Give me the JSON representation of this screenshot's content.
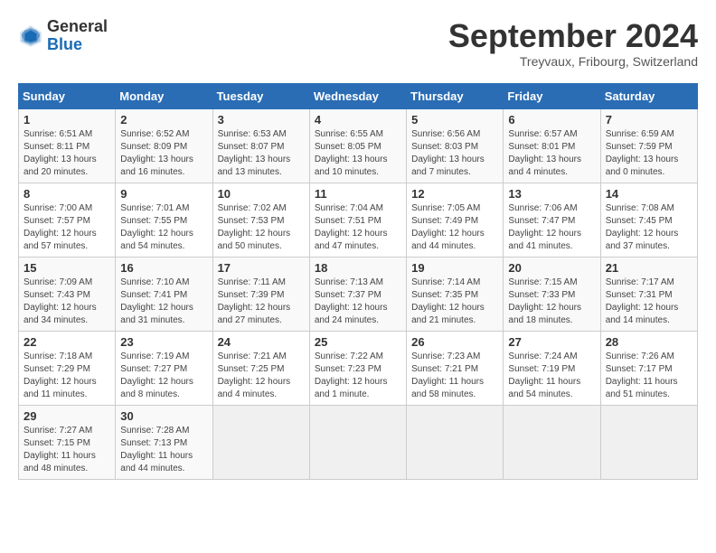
{
  "logo": {
    "general": "General",
    "blue": "Blue"
  },
  "title": "September 2024",
  "location": "Treyvaux, Fribourg, Switzerland",
  "headers": [
    "Sunday",
    "Monday",
    "Tuesday",
    "Wednesday",
    "Thursday",
    "Friday",
    "Saturday"
  ],
  "weeks": [
    [
      {
        "day": "1",
        "sunrise": "6:51 AM",
        "sunset": "8:11 PM",
        "daylight": "13 hours and 20 minutes."
      },
      {
        "day": "2",
        "sunrise": "6:52 AM",
        "sunset": "8:09 PM",
        "daylight": "13 hours and 16 minutes."
      },
      {
        "day": "3",
        "sunrise": "6:53 AM",
        "sunset": "8:07 PM",
        "daylight": "13 hours and 13 minutes."
      },
      {
        "day": "4",
        "sunrise": "6:55 AM",
        "sunset": "8:05 PM",
        "daylight": "13 hours and 10 minutes."
      },
      {
        "day": "5",
        "sunrise": "6:56 AM",
        "sunset": "8:03 PM",
        "daylight": "13 hours and 7 minutes."
      },
      {
        "day": "6",
        "sunrise": "6:57 AM",
        "sunset": "8:01 PM",
        "daylight": "13 hours and 4 minutes."
      },
      {
        "day": "7",
        "sunrise": "6:59 AM",
        "sunset": "7:59 PM",
        "daylight": "13 hours and 0 minutes."
      }
    ],
    [
      {
        "day": "8",
        "sunrise": "7:00 AM",
        "sunset": "7:57 PM",
        "daylight": "12 hours and 57 minutes."
      },
      {
        "day": "9",
        "sunrise": "7:01 AM",
        "sunset": "7:55 PM",
        "daylight": "12 hours and 54 minutes."
      },
      {
        "day": "10",
        "sunrise": "7:02 AM",
        "sunset": "7:53 PM",
        "daylight": "12 hours and 50 minutes."
      },
      {
        "day": "11",
        "sunrise": "7:04 AM",
        "sunset": "7:51 PM",
        "daylight": "12 hours and 47 minutes."
      },
      {
        "day": "12",
        "sunrise": "7:05 AM",
        "sunset": "7:49 PM",
        "daylight": "12 hours and 44 minutes."
      },
      {
        "day": "13",
        "sunrise": "7:06 AM",
        "sunset": "7:47 PM",
        "daylight": "12 hours and 41 minutes."
      },
      {
        "day": "14",
        "sunrise": "7:08 AM",
        "sunset": "7:45 PM",
        "daylight": "12 hours and 37 minutes."
      }
    ],
    [
      {
        "day": "15",
        "sunrise": "7:09 AM",
        "sunset": "7:43 PM",
        "daylight": "12 hours and 34 minutes."
      },
      {
        "day": "16",
        "sunrise": "7:10 AM",
        "sunset": "7:41 PM",
        "daylight": "12 hours and 31 minutes."
      },
      {
        "day": "17",
        "sunrise": "7:11 AM",
        "sunset": "7:39 PM",
        "daylight": "12 hours and 27 minutes."
      },
      {
        "day": "18",
        "sunrise": "7:13 AM",
        "sunset": "7:37 PM",
        "daylight": "12 hours and 24 minutes."
      },
      {
        "day": "19",
        "sunrise": "7:14 AM",
        "sunset": "7:35 PM",
        "daylight": "12 hours and 21 minutes."
      },
      {
        "day": "20",
        "sunrise": "7:15 AM",
        "sunset": "7:33 PM",
        "daylight": "12 hours and 18 minutes."
      },
      {
        "day": "21",
        "sunrise": "7:17 AM",
        "sunset": "7:31 PM",
        "daylight": "12 hours and 14 minutes."
      }
    ],
    [
      {
        "day": "22",
        "sunrise": "7:18 AM",
        "sunset": "7:29 PM",
        "daylight": "12 hours and 11 minutes."
      },
      {
        "day": "23",
        "sunrise": "7:19 AM",
        "sunset": "7:27 PM",
        "daylight": "12 hours and 8 minutes."
      },
      {
        "day": "24",
        "sunrise": "7:21 AM",
        "sunset": "7:25 PM",
        "daylight": "12 hours and 4 minutes."
      },
      {
        "day": "25",
        "sunrise": "7:22 AM",
        "sunset": "7:23 PM",
        "daylight": "12 hours and 1 minute."
      },
      {
        "day": "26",
        "sunrise": "7:23 AM",
        "sunset": "7:21 PM",
        "daylight": "11 hours and 58 minutes."
      },
      {
        "day": "27",
        "sunrise": "7:24 AM",
        "sunset": "7:19 PM",
        "daylight": "11 hours and 54 minutes."
      },
      {
        "day": "28",
        "sunrise": "7:26 AM",
        "sunset": "7:17 PM",
        "daylight": "11 hours and 51 minutes."
      }
    ],
    [
      {
        "day": "29",
        "sunrise": "7:27 AM",
        "sunset": "7:15 PM",
        "daylight": "11 hours and 48 minutes."
      },
      {
        "day": "30",
        "sunrise": "7:28 AM",
        "sunset": "7:13 PM",
        "daylight": "11 hours and 44 minutes."
      },
      null,
      null,
      null,
      null,
      null
    ]
  ]
}
